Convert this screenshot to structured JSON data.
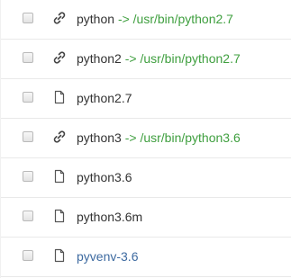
{
  "colors": {
    "text": "#333333",
    "symlink_target": "#3f9f3f",
    "highlighted_file": "#3d6aa0"
  },
  "files": [
    {
      "type": "symlink",
      "icon": "link-icon",
      "name": "python",
      "arrow": "->",
      "target": "/usr/bin/python2.7"
    },
    {
      "type": "symlink",
      "icon": "link-icon",
      "name": "python2",
      "arrow": "->",
      "target": "/usr/bin/python2.7"
    },
    {
      "type": "file",
      "icon": "file-icon",
      "name": "python2.7"
    },
    {
      "type": "symlink",
      "icon": "link-icon",
      "name": "python3",
      "arrow": "->",
      "target": "/usr/bin/python3.6"
    },
    {
      "type": "file",
      "icon": "file-icon",
      "name": "python3.6"
    },
    {
      "type": "file",
      "icon": "file-icon",
      "name": "python3.6m"
    },
    {
      "type": "file",
      "icon": "file-icon",
      "name": "pyvenv-3.6",
      "highlighted": true
    }
  ]
}
